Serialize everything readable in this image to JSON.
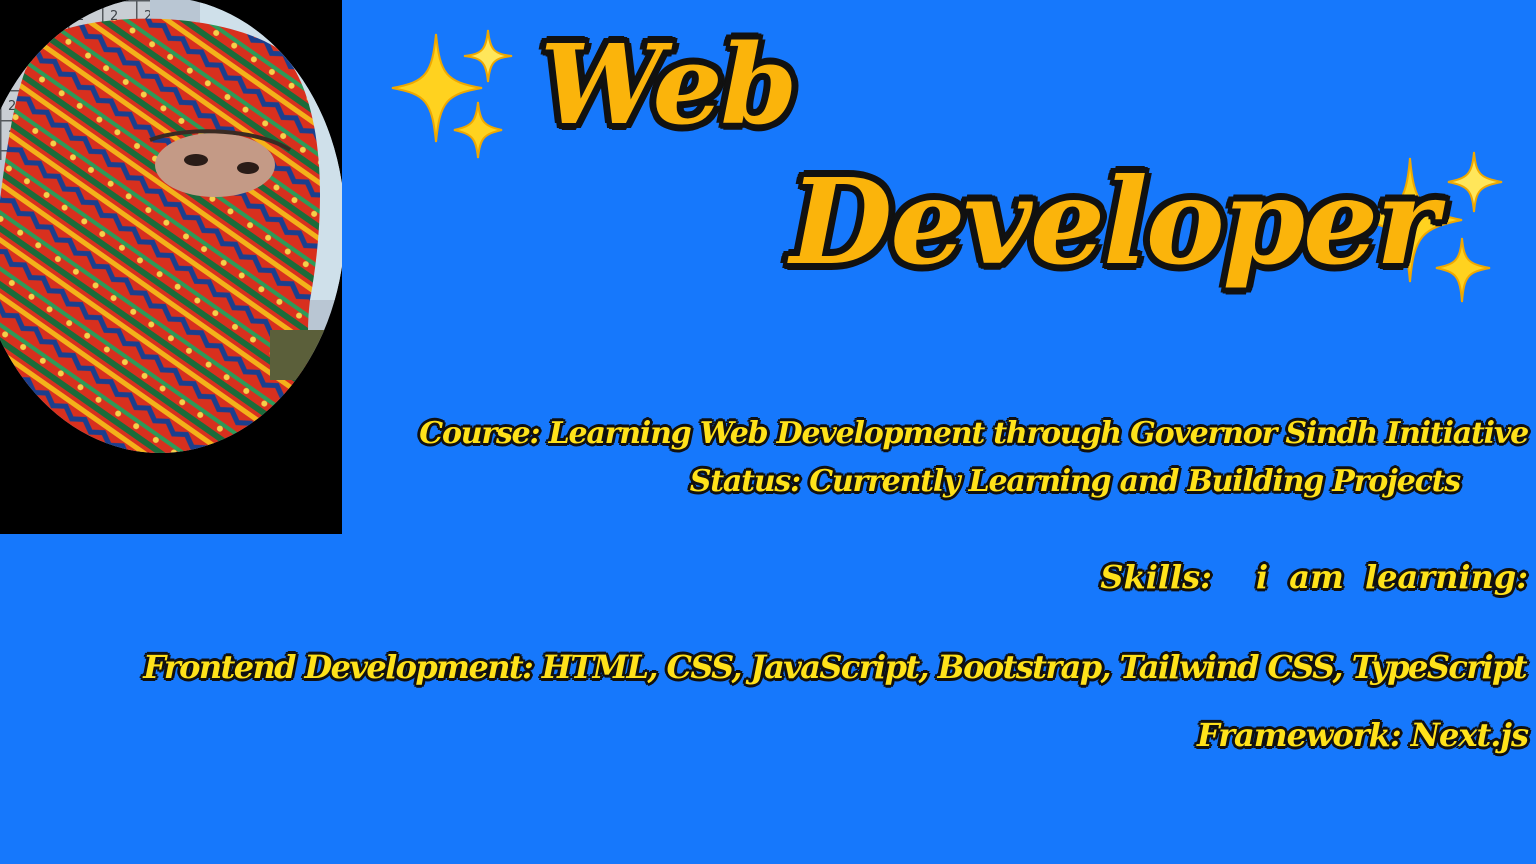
{
  "title": {
    "line1": "Web",
    "line2": "Developer"
  },
  "profile": {
    "photo_icon": "profile-photo",
    "sparkle_icon": "sparkles-emoji"
  },
  "details": {
    "course": "Course: Learning Web Development through Governor Sindh Initiative",
    "status": "Status: Currently Learning and Building Projects",
    "skills_label": "Skills:",
    "skills_value": "i am  learning:",
    "frontend": "Frontend Development: HTML, CSS, JavaScript, Bootstrap, Tailwind CSS, TypeScript",
    "framework": "Framework: Next.js"
  },
  "colors": {
    "background": "#1678fc",
    "title_text": "#fbb40b",
    "body_text": "#ffe21a",
    "outline": "#111111",
    "photo_frame": "#000000"
  }
}
